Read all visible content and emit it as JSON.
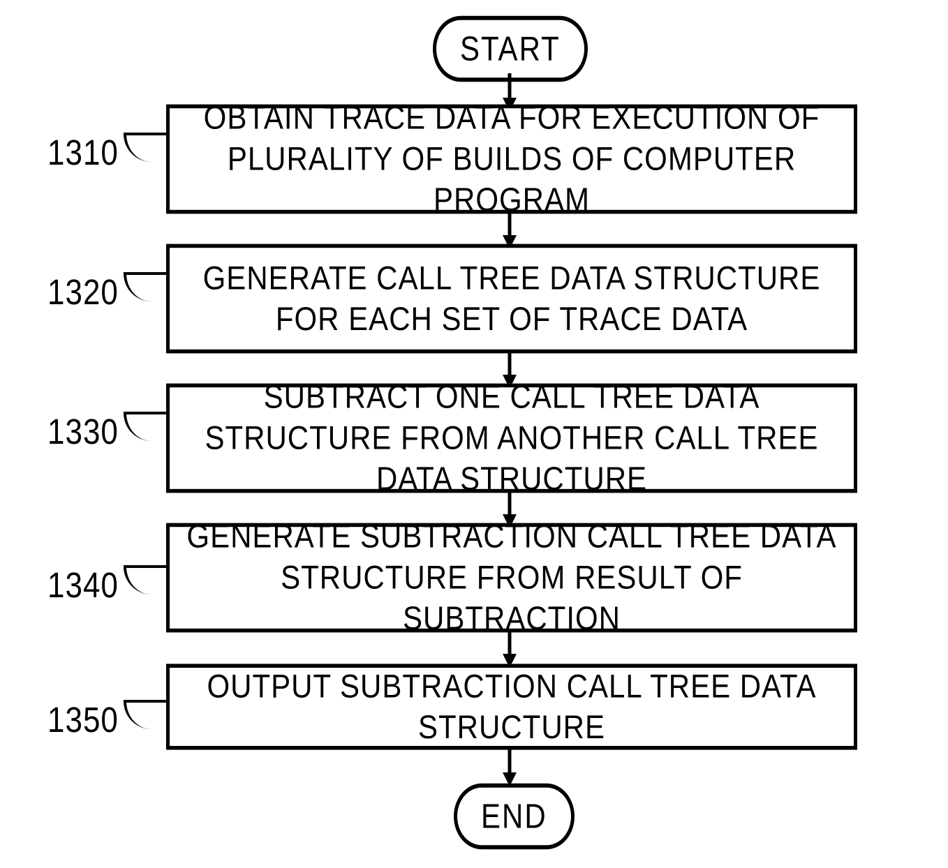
{
  "chart_data": {
    "type": "flowchart",
    "title": "",
    "nodes": [
      {
        "id": "start",
        "type": "terminator",
        "text": "START"
      },
      {
        "id": "1310",
        "type": "process",
        "label": "1310",
        "text": "OBTAIN TRACE DATA FOR EXECUTION OF PLURALITY OF BUILDS OF COMPUTER PROGRAM"
      },
      {
        "id": "1320",
        "type": "process",
        "label": "1320",
        "text": "GENERATE CALL TREE DATA STRUCTURE FOR EACH SET OF TRACE DATA"
      },
      {
        "id": "1330",
        "type": "process",
        "label": "1330",
        "text": "SUBTRACT ONE CALL TREE DATA STRUCTURE FROM ANOTHER CALL TREE DATA STRUCTURE"
      },
      {
        "id": "1340",
        "type": "process",
        "label": "1340",
        "text": "GENERATE SUBTRACTION CALL TREE DATA STRUCTURE FROM RESULT OF SUBTRACTION"
      },
      {
        "id": "1350",
        "type": "process",
        "label": "1350",
        "text": "OUTPUT SUBTRACTION CALL TREE DATA STRUCTURE"
      },
      {
        "id": "end",
        "type": "terminator",
        "text": "END"
      }
    ],
    "edges": [
      [
        "start",
        "1310"
      ],
      [
        "1310",
        "1320"
      ],
      [
        "1320",
        "1330"
      ],
      [
        "1330",
        "1340"
      ],
      [
        "1340",
        "1350"
      ],
      [
        "1350",
        "end"
      ]
    ]
  },
  "start": {
    "text": "START"
  },
  "end": {
    "text": "END"
  },
  "step1": {
    "label": "1310",
    "text": "OBTAIN TRACE DATA FOR EXECUTION OF PLURALITY OF BUILDS OF COMPUTER PROGRAM"
  },
  "step2": {
    "label": "1320",
    "text": "GENERATE CALL TREE DATA STRUCTURE FOR EACH SET OF TRACE DATA"
  },
  "step3": {
    "label": "1330",
    "text": "SUBTRACT ONE CALL TREE DATA STRUCTURE FROM ANOTHER CALL TREE DATA STRUCTURE"
  },
  "step4": {
    "label": "1340",
    "text": "GENERATE SUBTRACTION CALL TREE DATA STRUCTURE FROM RESULT OF SUBTRACTION"
  },
  "step5": {
    "label": "1350",
    "text": "OUTPUT SUBTRACTION CALL TREE DATA STRUCTURE"
  }
}
